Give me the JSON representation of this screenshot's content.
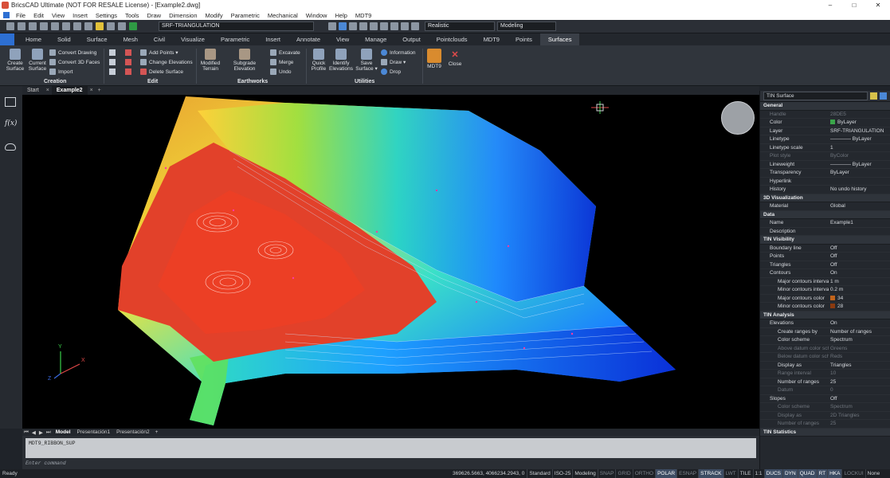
{
  "window": {
    "title": "BricsCAD Ultimate (NOT FOR RESALE License) - [Example2.dwg]",
    "minimize": "–",
    "maximize": "□",
    "close": "✕"
  },
  "menu": [
    "File",
    "Edit",
    "View",
    "Insert",
    "Settings",
    "Tools",
    "Draw",
    "Dimension",
    "Modify",
    "Parametric",
    "Mechanical",
    "Window",
    "Help",
    "MDT9"
  ],
  "qat": {
    "layer": "SRF-TRIANGULATION",
    "visual_style": "Realistic",
    "workspace": "Modeling"
  },
  "ribbon_tabs": [
    "Home",
    "Solid",
    "Surface",
    "Mesh",
    "Civil",
    "Visualize",
    "Parametric",
    "Insert",
    "Annotate",
    "View",
    "Manage",
    "Output",
    "Pointclouds",
    "MDT9",
    "Points",
    "Surfaces"
  ],
  "active_ribbon_tab": "Surfaces",
  "ribbon": {
    "creation": {
      "title": "Creation",
      "create_surface": "Create\nSurface",
      "current_surface": "Current\nSurface",
      "convert_drawing": "Convert Drawing",
      "convert_3d_faces": "Convert 3D Faces",
      "import": "Import"
    },
    "edit": {
      "title": "Edit",
      "add_points": "Add Points ▾",
      "change_elevations": "Change Elevations",
      "delete_surface": "Delete Surface"
    },
    "earthworks": {
      "title": "Earthworks",
      "modified_terrain": "Modified\nTerrain",
      "subgrade_elevation": "Subgrade Elevation",
      "excavate": "Excavate",
      "merge": "Merge",
      "undo": "Undo"
    },
    "utilities": {
      "title": "Utilities",
      "quick_profile": "Quick\nProfile",
      "identify_elevations": "Identify\nElevations",
      "save_surface": "Save\nSurface ▾",
      "information": "Information",
      "draw": "Draw ▾",
      "drop": "Drop"
    },
    "mdt9": "MDT9",
    "close": "Close"
  },
  "doc_tabs": [
    "Start",
    "Example2"
  ],
  "active_doc_tab": "Example2",
  "layout_tabs": [
    "Model",
    "Presentación1",
    "Presentación2"
  ],
  "command": {
    "history": "MDT9_RIBBON_SUP",
    "prompt": "Enter command"
  },
  "status": {
    "ready": "Ready",
    "coords": "369626.5663, 4066234.2943, 0",
    "items": [
      {
        "t": "Standard",
        "s": "n"
      },
      {
        "t": "ISO-25",
        "s": "n"
      },
      {
        "t": "Modeling",
        "s": "n"
      },
      {
        "t": "SNAP",
        "s": "off"
      },
      {
        "t": "GRID",
        "s": "off"
      },
      {
        "t": "ORTHO",
        "s": "off"
      },
      {
        "t": "POLAR",
        "s": "on"
      },
      {
        "t": "ESNAP",
        "s": "off"
      },
      {
        "t": "STRACK",
        "s": "on"
      },
      {
        "t": "LWT",
        "s": "off"
      },
      {
        "t": "TILE",
        "s": "n"
      },
      {
        "t": "1:1",
        "s": "n"
      },
      {
        "t": "DUCS",
        "s": "on"
      },
      {
        "t": "DYN",
        "s": "on"
      },
      {
        "t": "QUAD",
        "s": "on"
      },
      {
        "t": "RT",
        "s": "on"
      },
      {
        "t": "HKA",
        "s": "on"
      },
      {
        "t": "LOCKUI",
        "s": "off"
      },
      {
        "t": "None",
        "s": "n"
      }
    ]
  },
  "props": {
    "selector": "TIN Surface",
    "sections": [
      {
        "title": "General",
        "rows": [
          {
            "k": "Handle",
            "v": "28DE5",
            "dim": true
          },
          {
            "k": "Color",
            "v": "ByLayer",
            "sw": "#3aa54a"
          },
          {
            "k": "Layer",
            "v": "SRF-TRIANGULATION"
          },
          {
            "k": "Linetype",
            "v": "———— ByLayer"
          },
          {
            "k": "Linetype scale",
            "v": "1"
          },
          {
            "k": "Plot style",
            "v": "ByColor",
            "dim": true
          },
          {
            "k": "Lineweight",
            "v": "———— ByLayer"
          },
          {
            "k": "Transparency",
            "v": "ByLayer"
          },
          {
            "k": "Hyperlink",
            "v": ""
          },
          {
            "k": "History",
            "v": "No undo history"
          }
        ]
      },
      {
        "title": "3D Visualization",
        "rows": [
          {
            "k": "Material",
            "v": "Global"
          }
        ]
      },
      {
        "title": "Data",
        "rows": [
          {
            "k": "Name",
            "v": "Example1"
          },
          {
            "k": "Description",
            "v": ""
          }
        ]
      },
      {
        "title": "TIN Visibility",
        "rows": [
          {
            "k": "Boundary line",
            "v": "Off"
          },
          {
            "k": "Points",
            "v": "Off"
          },
          {
            "k": "Triangles",
            "v": "Off"
          },
          {
            "k": "Contours",
            "v": "On",
            "exp": true
          },
          {
            "k": "Major contours interval",
            "v": "1 m",
            "sub": true
          },
          {
            "k": "Minor contours interval",
            "v": "0.2 m",
            "sub": true
          },
          {
            "k": "Major contours color",
            "v": "34",
            "sw": "#c2641c",
            "sub": true
          },
          {
            "k": "Minor contours color",
            "v": "28",
            "sw": "#8a3a10",
            "sub": true
          }
        ]
      },
      {
        "title": "TIN Analysis",
        "rows": [
          {
            "k": "Elevations",
            "v": "On",
            "exp": true
          },
          {
            "k": "Create ranges by",
            "v": "Number of ranges",
            "sub": true
          },
          {
            "k": "Color scheme",
            "v": "Spectrum",
            "sub": true
          },
          {
            "k": "Above datum color scheme",
            "v": "Greens",
            "sub": true,
            "dim": true
          },
          {
            "k": "Below datum color scheme",
            "v": "Reds",
            "sub": true,
            "dim": true
          },
          {
            "k": "Display as",
            "v": "Triangles",
            "sub": true
          },
          {
            "k": "Range interval",
            "v": "10",
            "sub": true,
            "dim": true
          },
          {
            "k": "Number of ranges",
            "v": "25",
            "sub": true
          },
          {
            "k": "Datum",
            "v": "0",
            "sub": true,
            "dim": true
          },
          {
            "k": "Slopes",
            "v": "Off",
            "exp": true
          },
          {
            "k": "Color scheme",
            "v": "Spectrum",
            "sub": true,
            "dim": true
          },
          {
            "k": "Display as",
            "v": "2D Triangles",
            "sub": true,
            "dim": true
          },
          {
            "k": "Number of ranges",
            "v": "25",
            "sub": true,
            "dim": true
          }
        ]
      },
      {
        "title": "TIN Statistics",
        "rows": []
      }
    ]
  }
}
